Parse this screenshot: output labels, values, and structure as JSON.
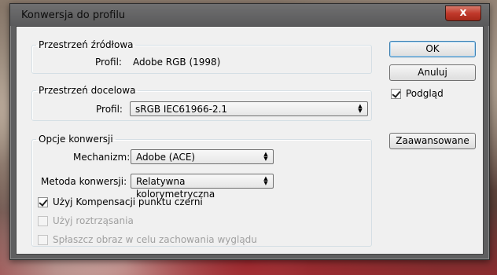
{
  "window": {
    "title": "Konwersja do profilu",
    "close_label": "x"
  },
  "source": {
    "legend": "Przestrzeń źródłowa",
    "profile_label": "Profil:",
    "profile_value": "Adobe RGB (1998)"
  },
  "destination": {
    "legend": "Przestrzeń docelowa",
    "profile_label": "Profil:",
    "profile_value": "sRGB IEC61966-2.1"
  },
  "conversion": {
    "legend": "Opcje konwersji",
    "engine_label": "Mechanizm:",
    "engine_value": "Adobe (ACE)",
    "intent_label": "Metoda konwersji:",
    "intent_value": "Relatywna kolorymetryczna",
    "bpc_label": "Użyj Kompensacji punktu czerni",
    "dither_label": "Użyj roztrząsania",
    "flatten_label": "Spłaszcz obraz w celu zachowania wyglądu"
  },
  "buttons": {
    "ok": "OK",
    "cancel": "Anuluj",
    "preview_label": "Podgląd",
    "advanced": "Zaawansowane"
  },
  "icons": {
    "updown": "updown-arrows-icon",
    "check": "checkmark-icon"
  }
}
